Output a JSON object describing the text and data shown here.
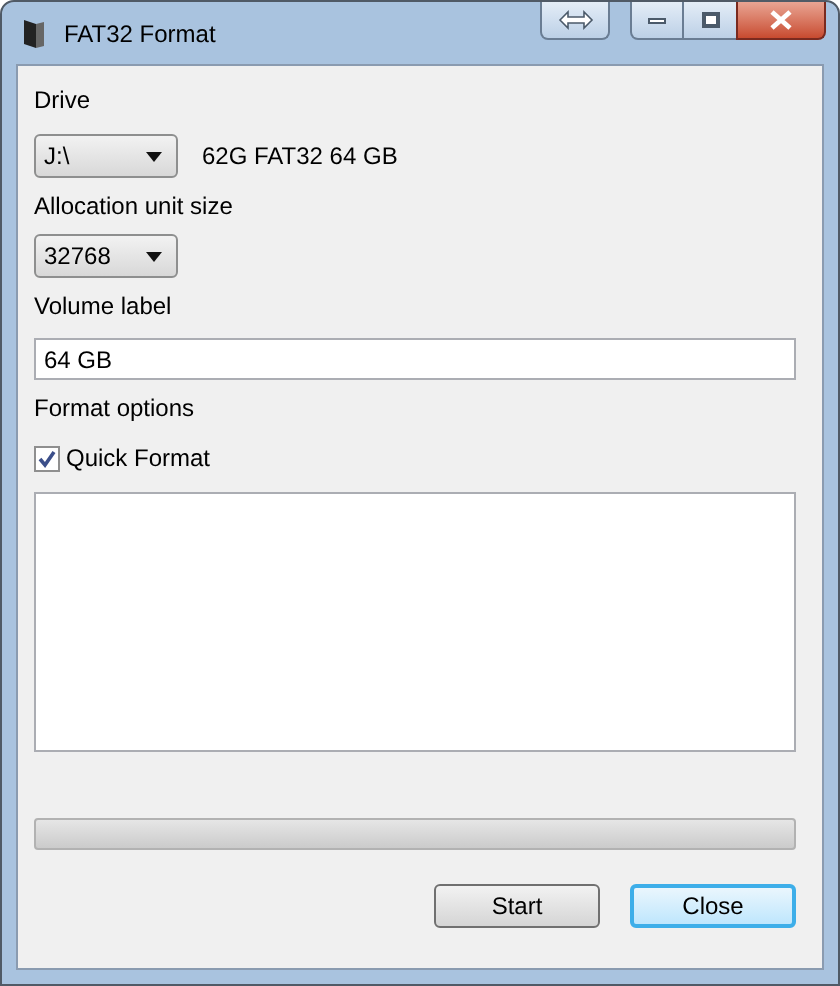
{
  "window": {
    "title": "FAT32 Format"
  },
  "drive": {
    "label": "Drive",
    "value": "J:\\",
    "info": "62G FAT32 64 GB"
  },
  "allocation": {
    "label": "Allocation unit size",
    "value": "32768"
  },
  "volume": {
    "label": "Volume label",
    "value": "64 GB"
  },
  "format_options": {
    "label": "Format options",
    "quick_format": {
      "label": "Quick Format",
      "checked": true
    }
  },
  "buttons": [
    {
      "label": "Start",
      "default": false
    },
    {
      "label": "Close",
      "default": true
    }
  ]
}
